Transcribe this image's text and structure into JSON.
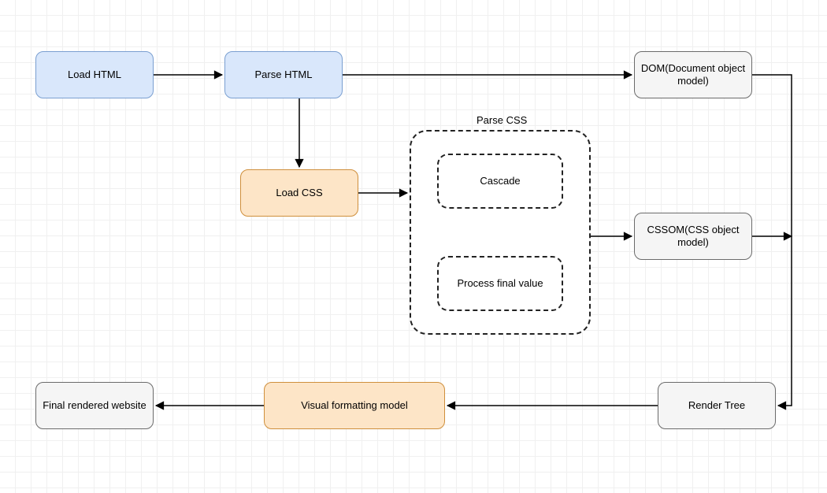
{
  "nodes": {
    "load_html": "Load HTML",
    "parse_html": "Parse HTML",
    "dom": "DOM(Document object model)",
    "load_css": "Load CSS",
    "parse_css_group": "Parse CSS",
    "cascade": "Cascade",
    "process_final_value": "Process final value",
    "cssom": "CSSOM(CSS object model)",
    "render_tree": "Render Tree",
    "visual_formatting_model": "Visual formatting model",
    "final_rendered_website": "Final rendered website"
  },
  "edges": [
    {
      "from": "load_html",
      "to": "parse_html"
    },
    {
      "from": "parse_html",
      "to": "dom"
    },
    {
      "from": "parse_html",
      "to": "load_css"
    },
    {
      "from": "load_css",
      "to": "parse_css_group"
    },
    {
      "from": "parse_css_group",
      "to": "cssom"
    },
    {
      "from": "dom",
      "to": "render_tree",
      "via": "right-down"
    },
    {
      "from": "cssom",
      "to": "render_tree",
      "via": "right-down"
    },
    {
      "from": "render_tree",
      "to": "visual_formatting_model"
    },
    {
      "from": "visual_formatting_model",
      "to": "final_rendered_website"
    }
  ]
}
